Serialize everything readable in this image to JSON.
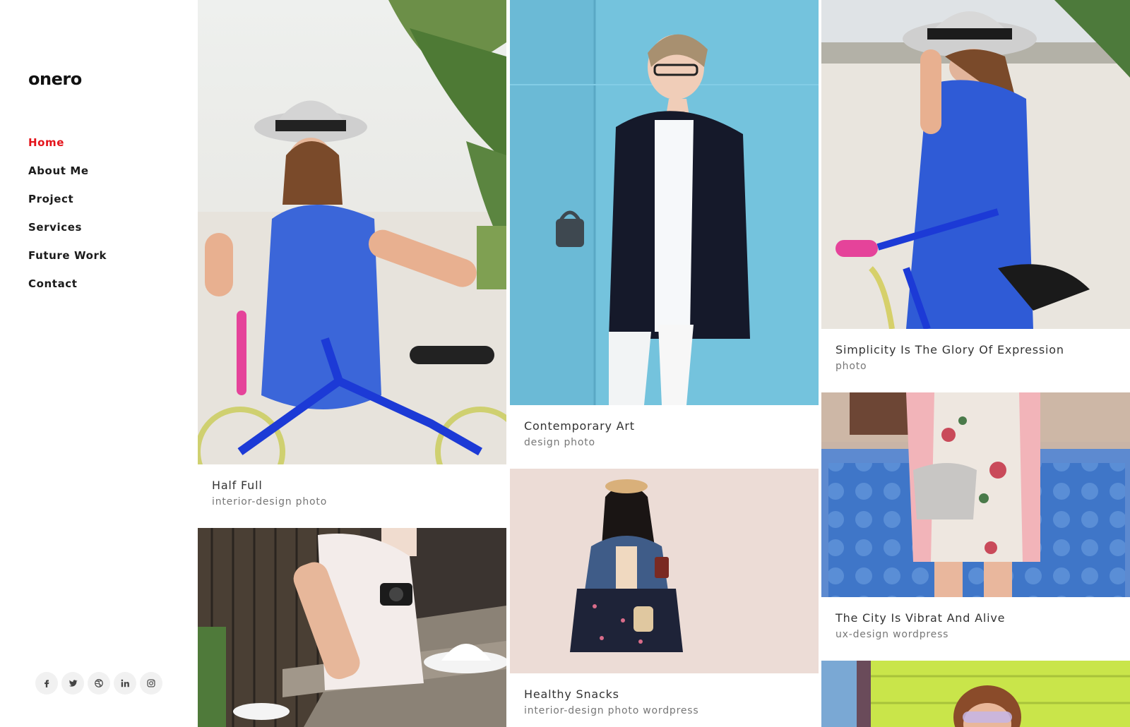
{
  "brand": {
    "logo": "onero"
  },
  "nav": {
    "items": [
      {
        "label": "Home",
        "active": true
      },
      {
        "label": "About Me"
      },
      {
        "label": "Project"
      },
      {
        "label": "Services"
      },
      {
        "label": "Future Work"
      },
      {
        "label": "Contact"
      }
    ]
  },
  "social": [
    "facebook-icon",
    "twitter-icon",
    "dribbble-icon",
    "linkedin-icon",
    "instagram-icon"
  ],
  "portfolio": {
    "col1": [
      {
        "title": "Half Full",
        "categories": "interior-design photo"
      },
      {
        "title": "",
        "categories": ""
      }
    ],
    "col2": [
      {
        "title": "Contemporary Art",
        "categories": "design photo"
      },
      {
        "title": "Healthy Snacks",
        "categories": "interior-design photo wordpress"
      }
    ],
    "col3": [
      {
        "title": "Simplicity Is The Glory Of Expression",
        "categories": "photo"
      },
      {
        "title": "The City Is Vibrat And Alive",
        "categories": "ux-design wordpress"
      }
    ]
  },
  "colors": {
    "accent": "#e4141b",
    "text": "#1b1b1b",
    "muted": "#777777"
  }
}
